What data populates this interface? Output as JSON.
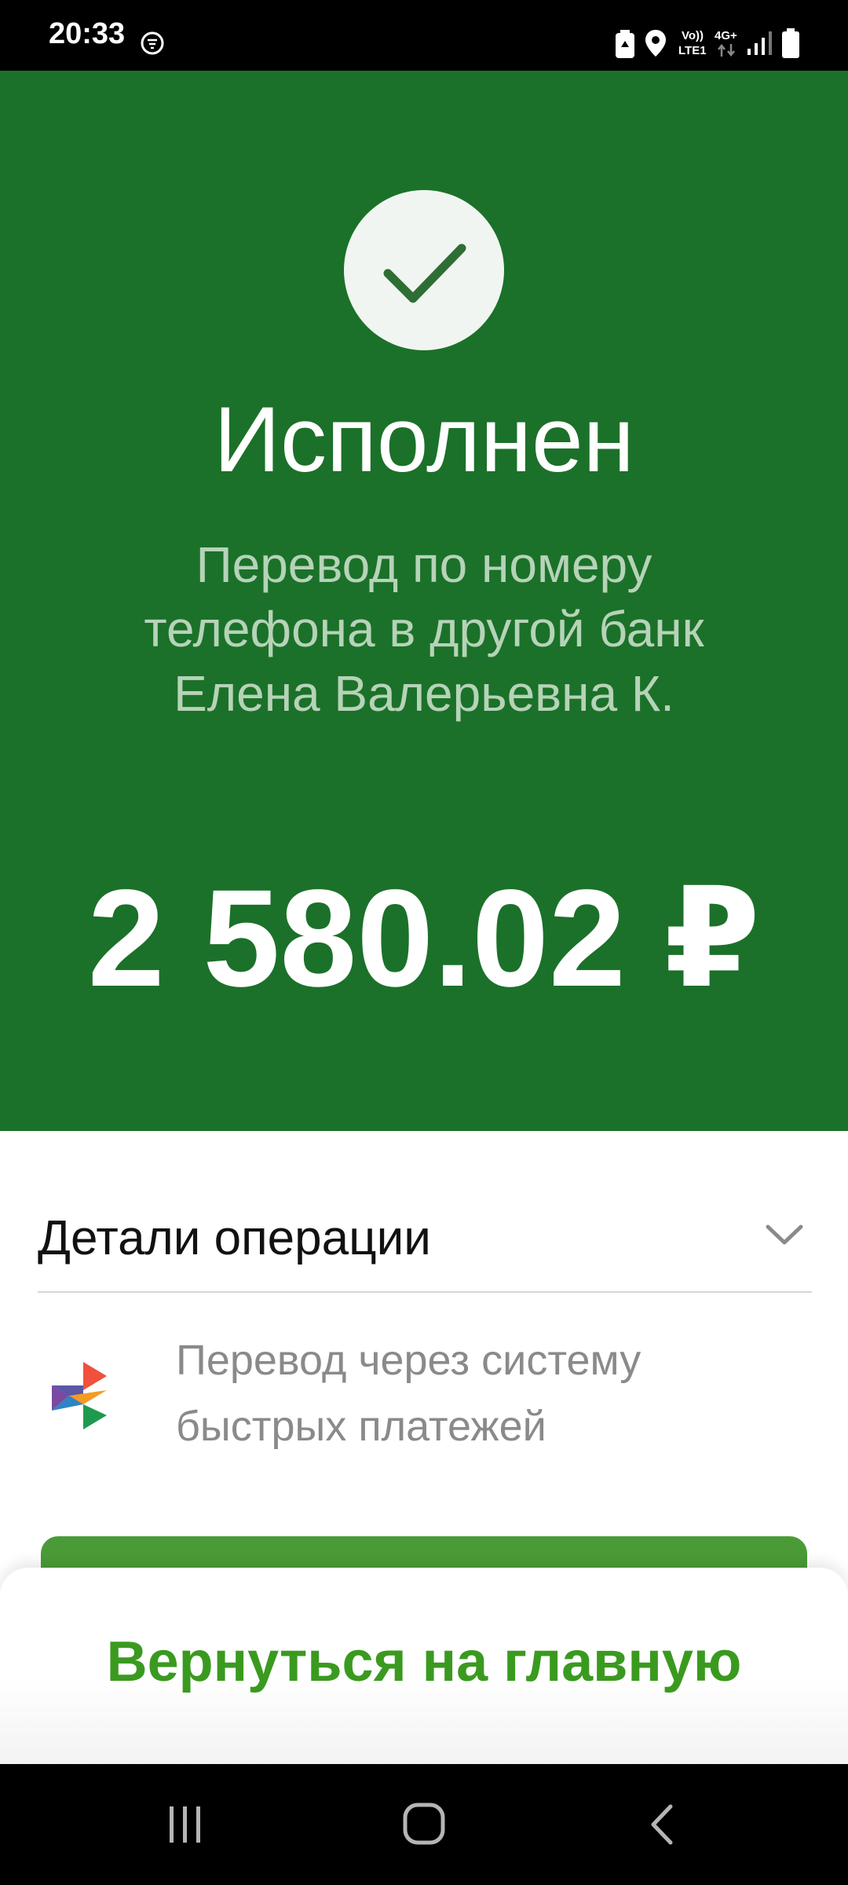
{
  "status_bar": {
    "time": "20:33",
    "volte_label": "Vo))",
    "lte_label": "LTE1",
    "network_label": "4G+",
    "icons": [
      "notification-icon",
      "battery-saver-icon",
      "location-icon",
      "signal-icon",
      "battery-icon"
    ]
  },
  "result": {
    "status": "Исполнен",
    "description_lines": [
      "Перевод по номеру",
      "телефона в другой банк",
      "Елена Валерьевна К."
    ],
    "amount": "2 580.02 ₽",
    "icon": "checkmark-icon",
    "colors": {
      "header_background": "#1b7129",
      "check_circle": "#f1f5f1",
      "checkmark": "#2e6e34"
    }
  },
  "details": {
    "title": "Детали операции",
    "toggle_icon": "chevron-down-icon",
    "payment_system": {
      "icon": "sbp-logo-icon",
      "lines": [
        "Перевод через систему",
        "быстрых платежей"
      ]
    }
  },
  "bottom_sheet": {
    "home_button_label": "Вернуться на главную",
    "accent_color": "#3a9a1f"
  },
  "navigation": {
    "buttons": [
      "recent-apps-icon",
      "home-icon",
      "back-icon"
    ]
  }
}
